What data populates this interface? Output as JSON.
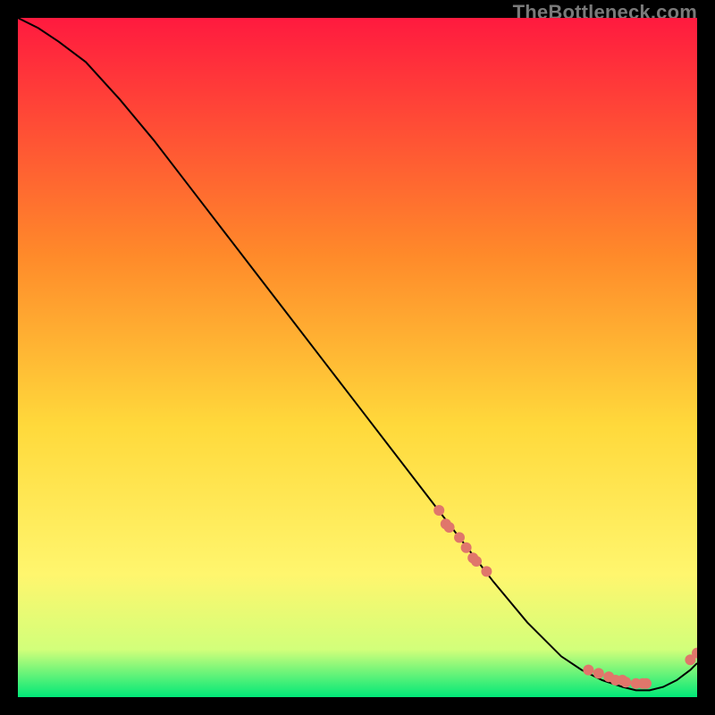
{
  "watermark": "TheBottleneck.com",
  "colors": {
    "gradient_top": "#ff1a3f",
    "gradient_mid_high": "#ff8a2a",
    "gradient_mid": "#ffd93b",
    "gradient_mid_low": "#fff66e",
    "gradient_low": "#d2ff7a",
    "gradient_bottom": "#00e878",
    "curve": "#000000",
    "marker": "#e0766b",
    "background": "#000000"
  },
  "chart_data": {
    "type": "line",
    "title": "",
    "xlabel": "",
    "ylabel": "",
    "xlim": [
      0,
      100
    ],
    "ylim": [
      0,
      100
    ],
    "curve": {
      "x": [
        0,
        3,
        6,
        10,
        15,
        20,
        25,
        30,
        35,
        40,
        45,
        50,
        55,
        60,
        65,
        70,
        75,
        80,
        83,
        86,
        89,
        91,
        93,
        95,
        97,
        99,
        100
      ],
      "y": [
        100,
        98.5,
        96.5,
        93.5,
        88,
        82,
        75.5,
        69,
        62.5,
        56,
        49.5,
        43,
        36.5,
        30,
        23.5,
        17,
        11,
        6,
        4,
        2.5,
        1.5,
        1,
        1,
        1.5,
        2.5,
        4,
        5
      ]
    },
    "markers": [
      {
        "x": 62,
        "y": 27.5
      },
      {
        "x": 63,
        "y": 25.5
      },
      {
        "x": 63.5,
        "y": 25
      },
      {
        "x": 65,
        "y": 23.5
      },
      {
        "x": 66,
        "y": 22
      },
      {
        "x": 67,
        "y": 20.5
      },
      {
        "x": 67.5,
        "y": 20
      },
      {
        "x": 69,
        "y": 18.5
      },
      {
        "x": 84,
        "y": 4
      },
      {
        "x": 85.5,
        "y": 3.5
      },
      {
        "x": 87,
        "y": 3
      },
      {
        "x": 88,
        "y": 2.5
      },
      {
        "x": 89,
        "y": 2.5
      },
      {
        "x": 89.5,
        "y": 2.2
      },
      {
        "x": 91,
        "y": 2
      },
      {
        "x": 92,
        "y": 2
      },
      {
        "x": 92.5,
        "y": 2
      },
      {
        "x": 99,
        "y": 5.5
      },
      {
        "x": 100,
        "y": 6.5
      }
    ]
  }
}
